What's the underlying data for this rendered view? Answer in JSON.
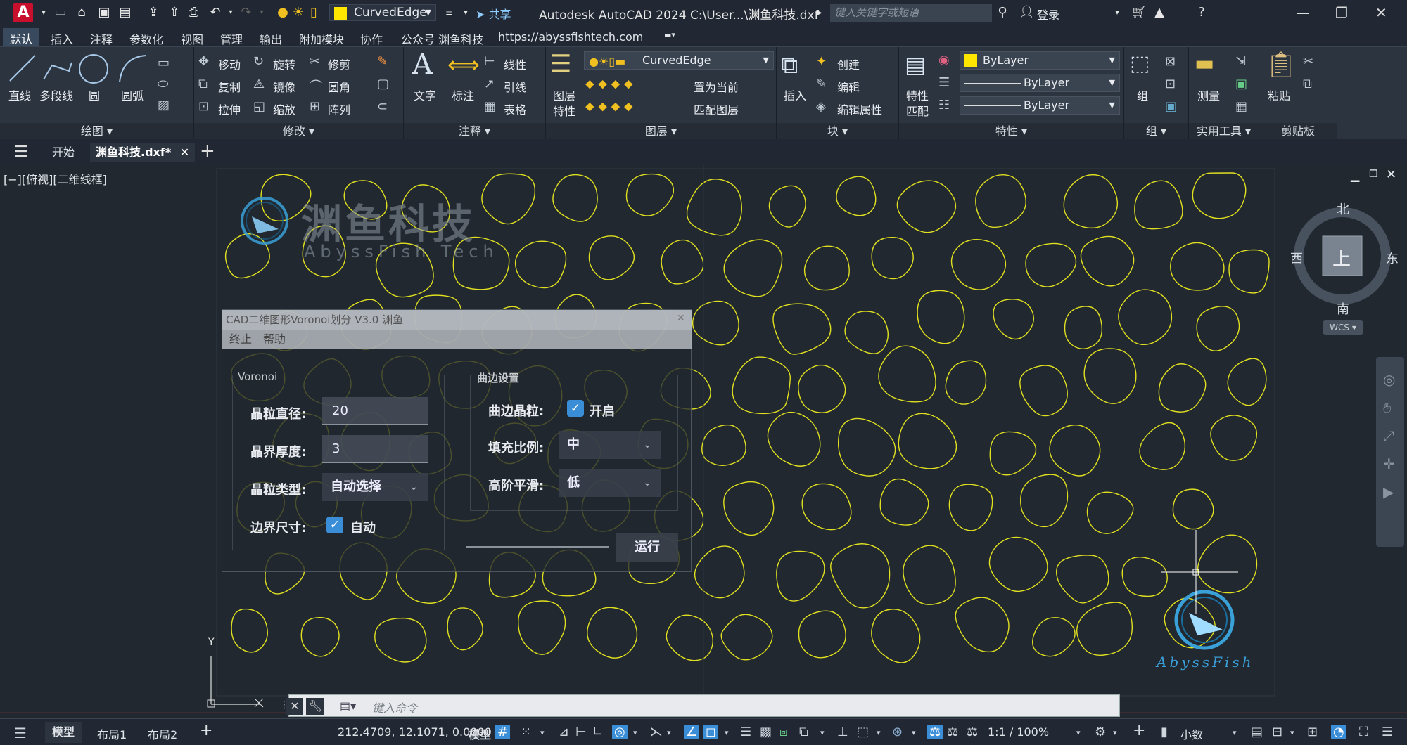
{
  "app": {
    "logo_letter": "A",
    "workspace": "CurvedEdge",
    "share_label": "共享",
    "title": "Autodesk AutoCAD 2024    C:\\User...\\渊鱼科技.dxf",
    "search_placeholder": "键入关键字或短语",
    "login_label": "登录"
  },
  "menus": [
    "默认",
    "插入",
    "注释",
    "参数化",
    "视图",
    "管理",
    "输出",
    "附加模块",
    "协作",
    "公众号 渊鱼科技",
    "https://abyssfishtech.com"
  ],
  "ribbon": {
    "draw": {
      "title": "绘图",
      "line": "直线",
      "polyline": "多段线",
      "circle": "圆",
      "arc": "圆弧"
    },
    "modify": {
      "title": "修改",
      "move": "移动",
      "rotate": "旋转",
      "trim": "修剪",
      "copy": "复制",
      "mirror": "镜像",
      "fillet": "圆角",
      "stretch": "拉伸",
      "scale": "缩放",
      "array": "阵列"
    },
    "annotation": {
      "title": "注释",
      "text": "文字",
      "dimension": "标注",
      "linetype": "线性",
      "leader": "引线",
      "table": "表格"
    },
    "layers": {
      "title": "图层",
      "props_l1": "图层",
      "props_l2": "特性",
      "layer_name": "CurvedEdge",
      "set_current": "置为当前",
      "match_layer": "匹配图层"
    },
    "block": {
      "title": "块",
      "insert": "插入",
      "create": "创建",
      "edit": "编辑",
      "edit_attr": "编辑属性"
    },
    "properties": {
      "title": "特性",
      "match_l1": "特性",
      "match_l2": "匹配",
      "color": "ByLayer",
      "linetype": "ByLayer",
      "lineweight": "ByLayer"
    },
    "groups": {
      "title": "组",
      "group": "组"
    },
    "utilities": {
      "title": "实用工具",
      "measure": "测量"
    },
    "clipboard": {
      "title": "剪贴板",
      "paste": "粘贴"
    }
  },
  "tabs": {
    "start": "开始",
    "doc": "渊鱼科技.dxf*"
  },
  "viewport": {
    "label": "[−][俯视][二维线框]",
    "north": "北",
    "south": "南",
    "east": "东",
    "west": "西",
    "top": "上",
    "wcs": "WCS",
    "logo_cn": "渊鱼科技",
    "logo_en": "AbyssFish Tech",
    "logo_en2": "AbyssFish",
    "y_axis": "Y"
  },
  "dialog": {
    "title": "CAD二维图形Voronoi划分 V3.0 渊鱼",
    "menu_stop": "终止",
    "menu_help": "帮助",
    "left_group": "Voronoi",
    "right_group": "曲边设置",
    "grain_diameter_label": "晶粒直径:",
    "grain_diameter": "20",
    "boundary_thickness_label": "晶界厚度:",
    "boundary_thickness": "3",
    "grain_type_label": "晶粒类型:",
    "grain_type": "自动选择",
    "border_size_label": "边界尺寸:",
    "border_auto": "自动",
    "curved_grain_label": "曲边晶粒:",
    "curved_on": "开启",
    "fill_ratio_label": "填充比例:",
    "fill_ratio": "中",
    "smoothing_label": "高阶平滑:",
    "smoothing": "低",
    "run": "运行"
  },
  "command": {
    "placeholder": "键入命令"
  },
  "status": {
    "model_tab": "模型",
    "layout1": "布局1",
    "layout2": "布局2",
    "coords": "212.4709, 12.1071, 0.0000",
    "model": "模型",
    "scale": "1:1 / 100%",
    "units": "小数"
  },
  "colors": {
    "accent": "#3a8ed8",
    "drawing_line": "#e0e020",
    "bylayer_swatch": "#ffe600"
  }
}
